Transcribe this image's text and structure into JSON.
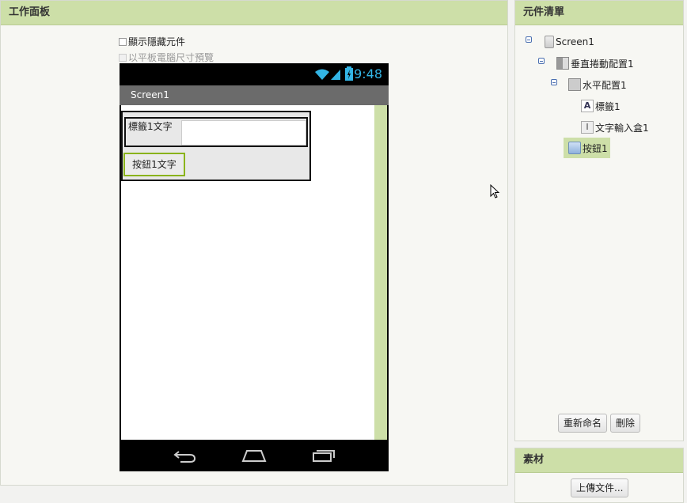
{
  "viewer": {
    "title": "工作面板",
    "show_hidden_label": "顯示隱藏元件",
    "tablet_preview_label": "以平板電腦尺寸預覽"
  },
  "phone": {
    "clock": "9:48",
    "screen_title": "Screen1",
    "label1_text": "標籤1文字",
    "textbox1_value": "",
    "button1_text": "按鈕1文字"
  },
  "components": {
    "title": "元件清單",
    "tree": {
      "screen": "Screen1",
      "vertical_scroll": "垂直捲動配置1",
      "horizontal": "水平配置1",
      "label": "標籤1",
      "textbox": "文字輸入盒1",
      "button": "按鈕1"
    },
    "rename_label": "重新命名",
    "delete_label": "刪除"
  },
  "media": {
    "title": "素材",
    "upload_label": "上傳文件..."
  },
  "colors": {
    "header_green": "#cddfa8",
    "clock_blue": "#33b5e5",
    "button_border": "#8ab31b"
  }
}
